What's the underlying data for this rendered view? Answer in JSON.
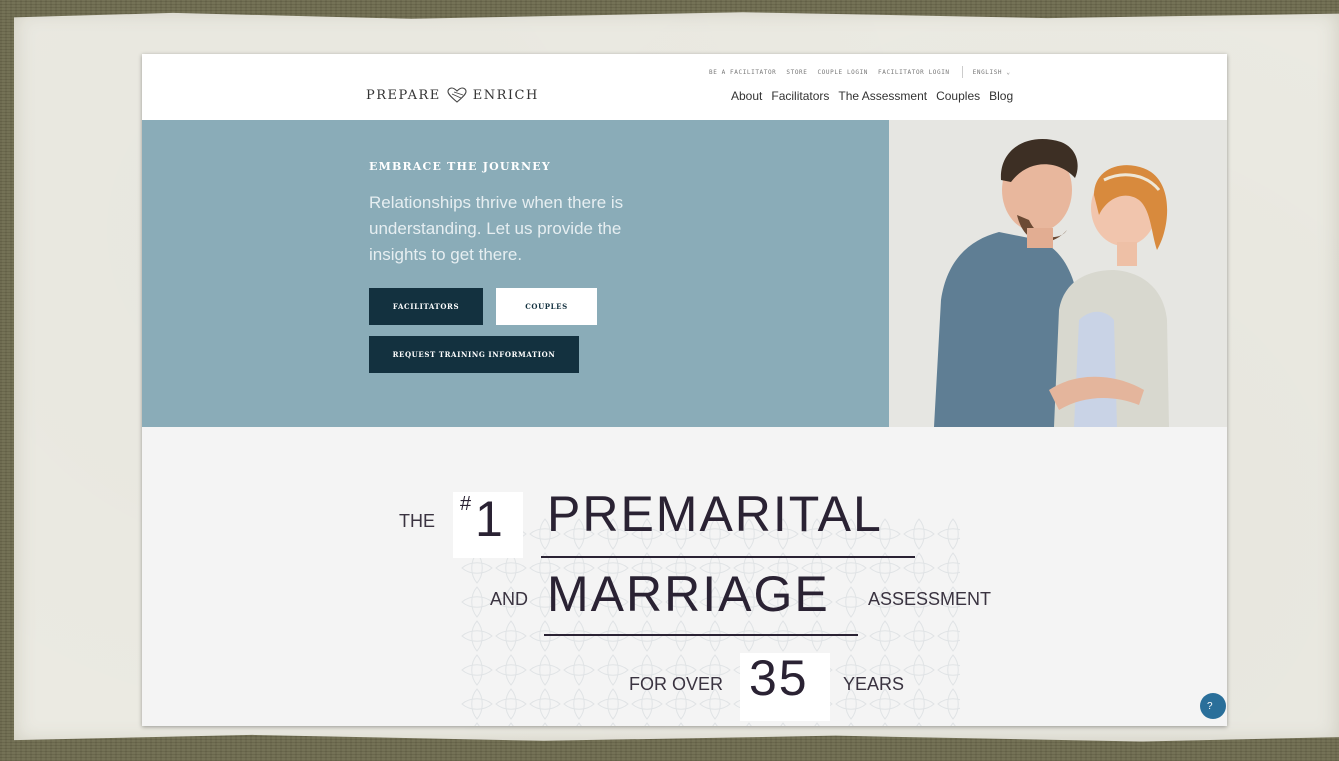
{
  "header": {
    "logo_left": "PREPARE",
    "logo_right": "ENRICH",
    "utility_links": [
      "BE A FACILITATOR",
      "STORE",
      "COUPLE LOGIN",
      "FACILITATOR LOGIN"
    ],
    "language": "ENGLISH ⌄",
    "nav": [
      "About",
      "Facilitators",
      "The Assessment",
      "Couples",
      "Blog"
    ]
  },
  "hero": {
    "kicker": "EMBRACE THE JOURNEY",
    "tagline": "Relationships thrive when there is understanding. Let us provide the insights to get there.",
    "btn_facilitators": "FACILITATORS",
    "btn_couples": "COUPLES",
    "btn_training": "REQUEST TRAINING INFORMATION"
  },
  "headline": {
    "the": "THE",
    "hash": "#",
    "one": "1",
    "premarital": "PREMARITAL",
    "and": "AND",
    "marriage": "MARRIAGE",
    "assessment": "ASSESSMENT",
    "for_over": "FOR OVER",
    "years_num": "35",
    "years": "YEARS"
  },
  "help": "?"
}
